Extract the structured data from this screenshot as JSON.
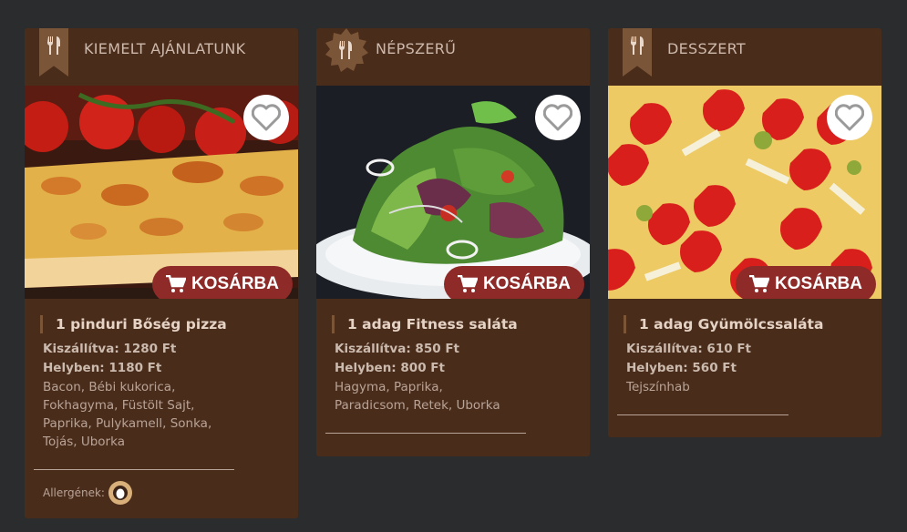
{
  "cards": [
    {
      "header": "KIEMELT AJÁNLATUNK",
      "badge": "ribbon",
      "icon": "utensils-icon",
      "cart_label": "KOSÁRBA",
      "name": "1 pinduri Bőség pizza",
      "delivered": "Kiszállítva: 1280 Ft",
      "onsite": "Helyben: 1180 Ft",
      "ingredients": "Bacon, Bébi kukorica, Fokhagyma, Füstölt Sajt, Paprika, Pulykamell, Sonka, Tojás, Uborka",
      "allergens_label": "Allergének:",
      "allergen_icon": "egg-icon"
    },
    {
      "header": "NÉPSZERŰ",
      "badge": "star",
      "icon": "utensils-icon",
      "cart_label": "KOSÁRBA",
      "name": "1 adag Fitness saláta",
      "delivered": "Kiszállítva: 850 Ft",
      "onsite": "Helyben: 800 Ft",
      "ingredients": "Hagyma, Paprika, Paradicsom, Retek, Uborka"
    },
    {
      "header": "DESSZERT",
      "badge": "ribbon",
      "icon": "utensils-icon",
      "cart_label": "KOSÁRBA",
      "name": "1 adag Gyümölcssaláta",
      "delivered": "Kiszállítva: 610 Ft",
      "onsite": "Helyben: 560 Ft",
      "ingredients": "Tejszínhab"
    }
  ],
  "colors": {
    "page_bg": "#2b2c2e",
    "card_bg": "#4a2c1b",
    "badge": "#7b5537",
    "cart_button": "#8e2a28"
  }
}
